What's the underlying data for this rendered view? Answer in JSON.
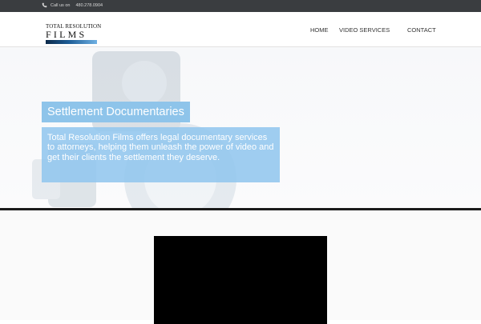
{
  "topbar": {
    "phone_prefix": "Call us on",
    "phone_number": "480.278.0904",
    "icon": "phone-icon"
  },
  "logo": {
    "line1": "TOTAL RESOLUTION",
    "line2": "FILMS"
  },
  "nav": {
    "items": [
      {
        "label": "HOME"
      },
      {
        "label": "VIDEO SERVICES"
      },
      {
        "label": "CONTACT"
      }
    ]
  },
  "hero": {
    "title": "Settlement Documentaries",
    "description": "Total Resolution Films offers legal documentary services to attorneys, helping them unleash the power of video and get their clients the settlement they deserve."
  },
  "colors": {
    "topbar_bg": "#3a3d40",
    "accent_blue": "#8ec4ea",
    "video_bg": "#000000"
  }
}
